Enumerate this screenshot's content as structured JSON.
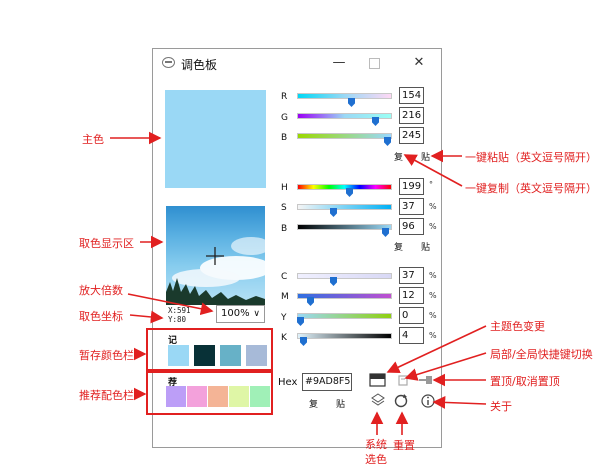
{
  "window": {
    "title": "调色板",
    "minimize_label": "—",
    "close_label": "✕"
  },
  "main_color": {
    "color": "#9ad8f5"
  },
  "picker": {
    "coord_x": "X:591",
    "coord_y": "Y:80"
  },
  "zoom": {
    "value": "100%"
  },
  "stored": {
    "label": "记",
    "colors": [
      "#9ad8f5",
      "#083137",
      "#67b1c7",
      "#a7bad8"
    ]
  },
  "recommended": {
    "label": "荐",
    "colors": [
      "#bc9ef7",
      "#f3a1db",
      "#f4b496",
      "#dff6a6",
      "#a0f0b7"
    ]
  },
  "rgb": {
    "labels": [
      "R",
      "G",
      "B"
    ],
    "values": [
      "154",
      "216",
      "245"
    ],
    "fractions": [
      0.604,
      0.847,
      0.961
    ],
    "copy": "复",
    "paste": "贴"
  },
  "hsb": {
    "labels": [
      "H",
      "S",
      "B"
    ],
    "values": [
      "199",
      "37",
      "96"
    ],
    "units": [
      "°",
      "%",
      "%"
    ],
    "fractions": [
      0.553,
      0.37,
      0.96
    ],
    "copy": "复",
    "paste": "贴"
  },
  "cmyk": {
    "labels": [
      "C",
      "M",
      "Y",
      "K"
    ],
    "values": [
      "37",
      "12",
      "0",
      "4"
    ],
    "units": [
      "%",
      "%",
      "%",
      "%"
    ],
    "fractions": [
      0.37,
      0.12,
      0.0,
      0.04
    ]
  },
  "hex": {
    "label": "Hex",
    "value": "#9AD8F5",
    "copy": "复",
    "paste": "贴"
  },
  "annotations": {
    "main_color": "主色",
    "picker_area": "取色显示区",
    "zoom_factor": "放大倍数",
    "picker_coord": "取色坐标",
    "stored_bar": "暂存颜色栏",
    "recommended_bar": "推荐配色栏",
    "paste_all": "一键粘贴（英文逗号隔开）",
    "copy_all": "一键复制（英文逗号隔开）",
    "theme_change": "主题色变更",
    "hotkey_toggle": "局部/全局快捷键切换",
    "pin_toggle": "置顶/取消置顶",
    "about": "关于",
    "system_color": "系统\n选色",
    "reset": "重置"
  },
  "colors": {
    "accent_red": "#e12020",
    "thumb_blue": "#1f6fd0"
  }
}
